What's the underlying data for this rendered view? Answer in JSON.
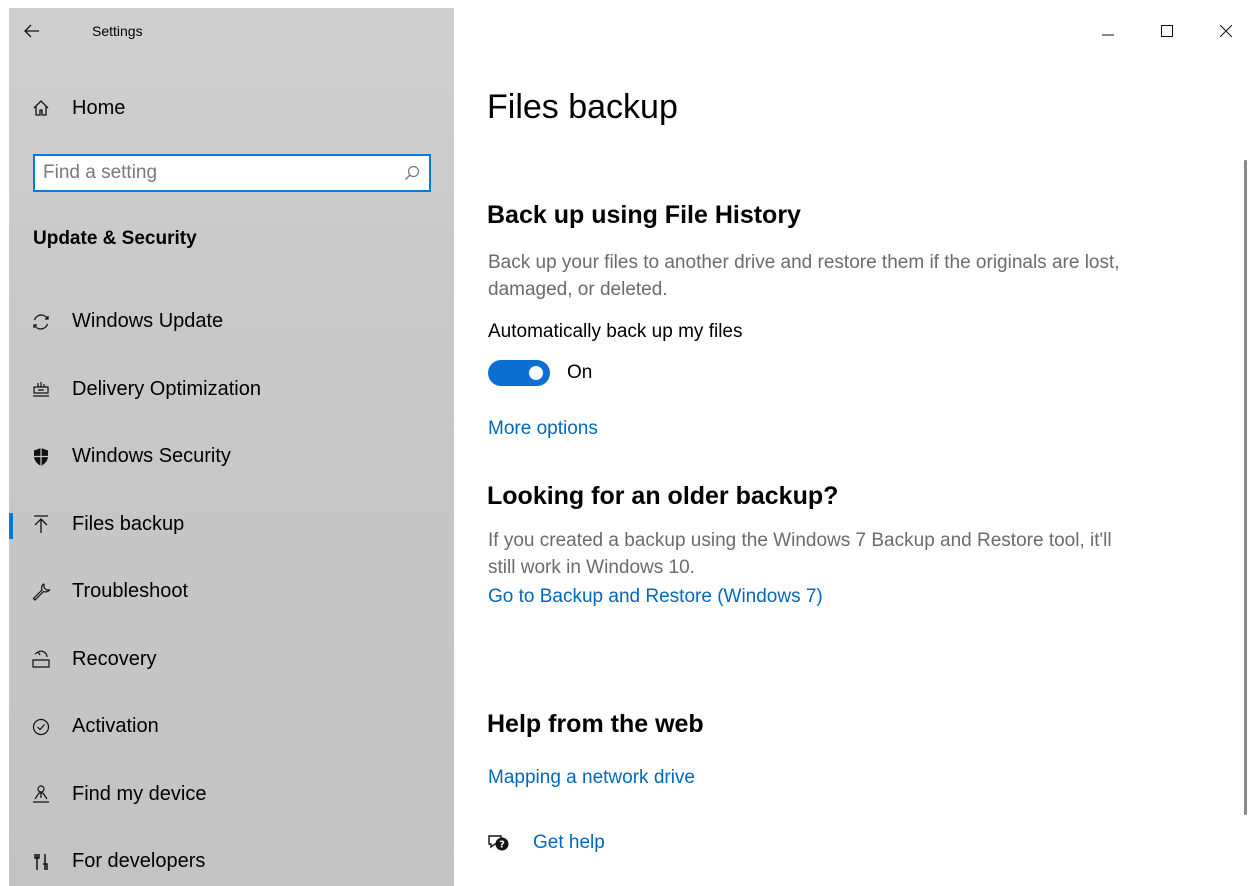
{
  "window": {
    "app_title": "Settings"
  },
  "sidebar": {
    "home_label": "Home",
    "search_placeholder": "Find a setting",
    "section_heading": "Update & Security",
    "items": [
      {
        "label": "Windows Update",
        "icon": "sync-icon"
      },
      {
        "label": "Delivery Optimization",
        "icon": "delivery-optimization-icon"
      },
      {
        "label": "Windows Security",
        "icon": "shield-icon"
      },
      {
        "label": "Files backup",
        "icon": "upload-arrow-icon",
        "selected": true
      },
      {
        "label": "Troubleshoot",
        "icon": "wrench-icon"
      },
      {
        "label": "Recovery",
        "icon": "recovery-icon"
      },
      {
        "label": "Activation",
        "icon": "check-circle-icon"
      },
      {
        "label": "Find my device",
        "icon": "person-location-icon"
      },
      {
        "label": "For developers",
        "icon": "developer-tools-icon"
      }
    ]
  },
  "content": {
    "page_title": "Files backup",
    "file_history": {
      "heading": "Back up using File History",
      "description": "Back up your files to another drive and restore them if the originals are lost, damaged, or deleted.",
      "toggle_label": "Automatically back up my files",
      "toggle_state": "On",
      "more_options": "More options"
    },
    "older_backup": {
      "heading": "Looking for an older backup?",
      "description": "If you created a backup using the Windows 7 Backup and Restore tool, it'll still work in Windows 10.",
      "link": "Go to Backup and Restore (Windows 7)"
    },
    "help": {
      "heading": "Help from the web",
      "link": "Mapping a network drive",
      "get_help": "Get help"
    }
  },
  "colors": {
    "accent": "#0a78d4",
    "link": "#0067c0",
    "sidebar_bg": "#c8c8c8"
  }
}
